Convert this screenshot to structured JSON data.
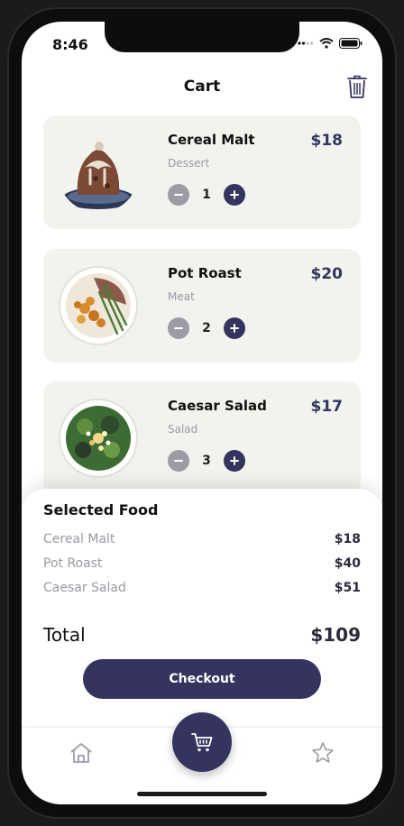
{
  "status_bar": {
    "time": "8:46"
  },
  "header": {
    "title": "Cart"
  },
  "cart_items": [
    {
      "name": "Cereal Malt",
      "category": "Dessert",
      "price": "$18",
      "quantity": "1"
    },
    {
      "name": "Pot Roast",
      "category": "Meat",
      "price": "$20",
      "quantity": "2"
    },
    {
      "name": "Caesar Salad",
      "category": "Salad",
      "price": "$17",
      "quantity": "3"
    }
  ],
  "summary": {
    "title": "Selected Food",
    "lines": [
      {
        "name": "Cereal Malt",
        "price": "$18"
      },
      {
        "name": "Pot Roast",
        "price": "$40"
      },
      {
        "name": "Caesar Salad",
        "price": "$51"
      }
    ],
    "total_label": "Total",
    "total_value": "$109",
    "checkout_label": "Checkout"
  },
  "tabbar": {
    "left": "home-icon",
    "center": "cart-icon",
    "right": "star-icon"
  },
  "colors": {
    "accent": "#34345e",
    "card_bg": "#f2f2ef",
    "muted_text": "#9a9aa2",
    "minus_button": "#9c9ca6"
  }
}
